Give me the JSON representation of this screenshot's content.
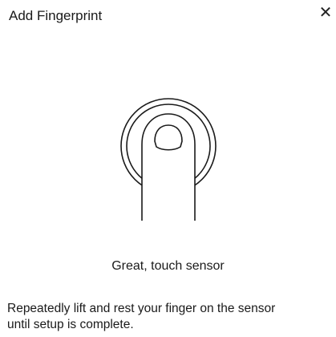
{
  "dialog": {
    "title": "Add Fingerprint",
    "close_label": "✕"
  },
  "illustration": {
    "icon": "finger-on-sensor-icon"
  },
  "status": {
    "message": "Great, touch sensor"
  },
  "instructions": {
    "line1": "Repeatedly lift and rest your finger on the sensor",
    "line2": "until setup is complete."
  },
  "colors": {
    "background": "#ffffff",
    "text": "#1a1a1a",
    "stroke": "#1a1a1a"
  }
}
